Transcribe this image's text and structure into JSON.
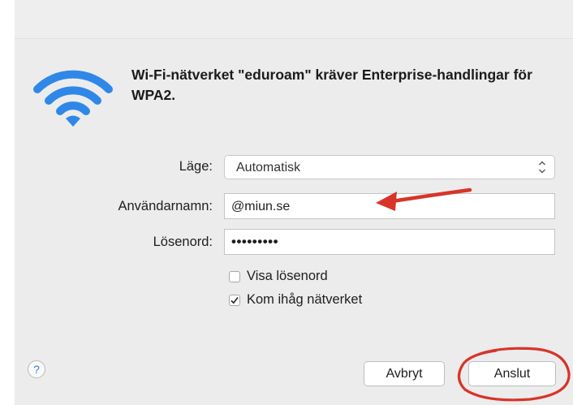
{
  "dialog": {
    "message": "Wi-Fi-nätverket \"eduroam\" kräver Enterprise-handlingar för WPA2."
  },
  "form": {
    "mode_label": "Läge:",
    "mode_value": "Automatisk",
    "username_label": "Användarnamn:",
    "username_value": "@miun.se",
    "password_label": "Lösenord:",
    "password_value": "•••••••••"
  },
  "options": {
    "show_password_label": "Visa lösenord",
    "show_password_checked": false,
    "remember_network_label": "Kom ihåg nätverket",
    "remember_network_checked": true
  },
  "buttons": {
    "help": "?",
    "cancel": "Avbryt",
    "connect": "Anslut"
  },
  "icons": {
    "wifi": "wifi-icon",
    "stepper": "select-stepper-icon",
    "check": "checkmark-icon",
    "annotation_arrow": "red-arrow-annotation",
    "annotation_circle": "red-circle-annotation"
  },
  "colors": {
    "wifi_blue": "#2f88e8",
    "annotation_red": "#d8342a",
    "panel_gray": "#ececec"
  }
}
